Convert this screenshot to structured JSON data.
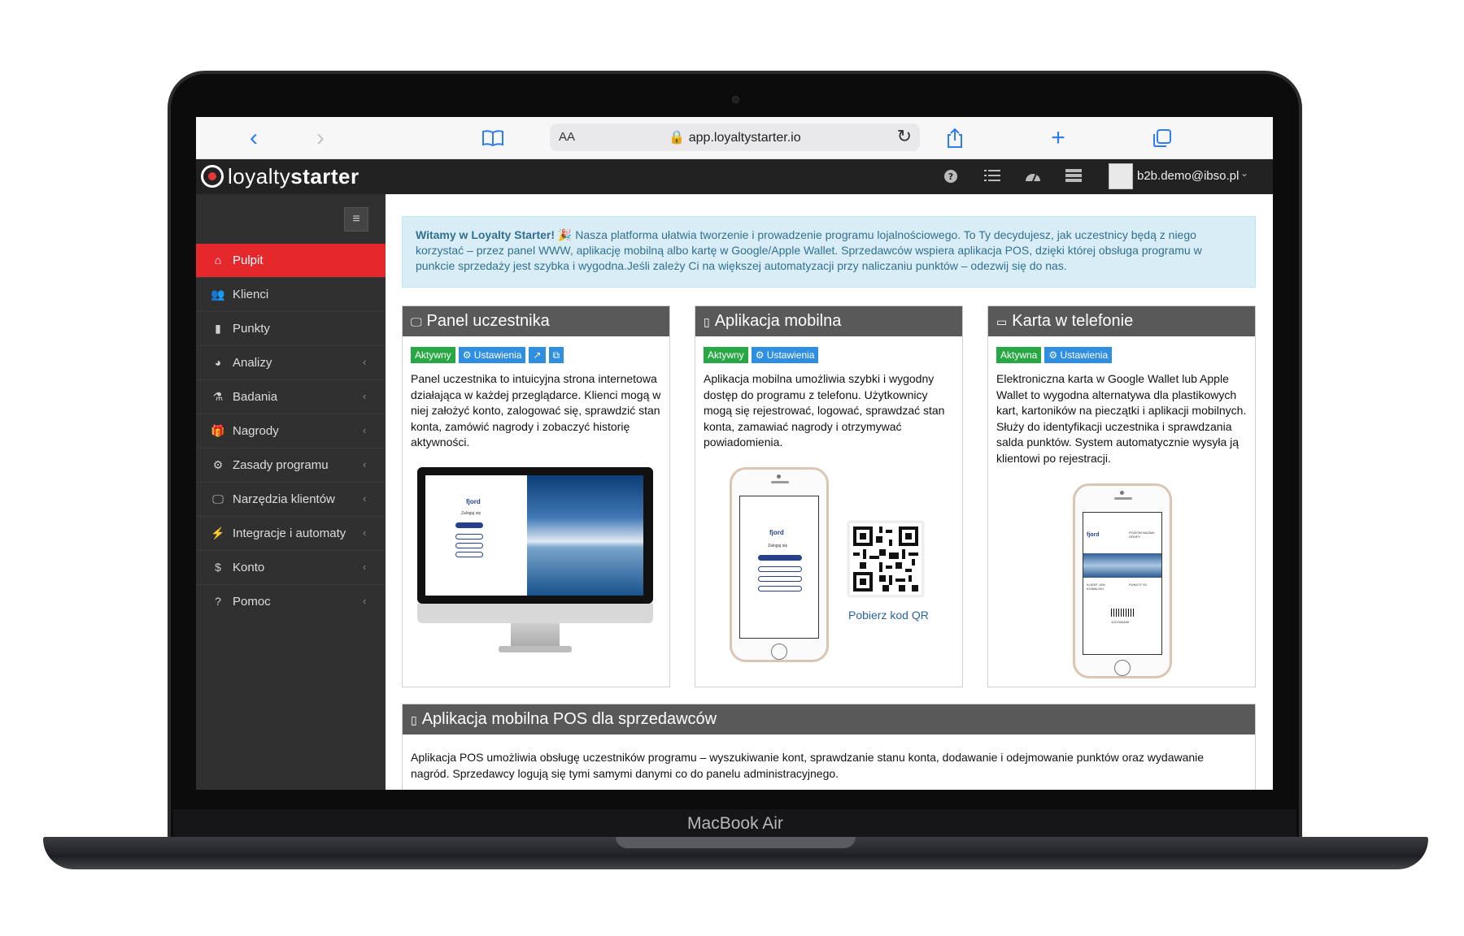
{
  "device": {
    "brand": "MacBook Air"
  },
  "browser": {
    "text_size_label": "AA",
    "url": "app.loyaltystarter.io",
    "icons": [
      "back-icon",
      "forward-icon",
      "bookmarks-icon",
      "reload-icon",
      "share-icon",
      "new-tab-icon",
      "tabs-icon"
    ]
  },
  "header": {
    "logo_light": "loyalty",
    "logo_bold": "starter",
    "user_email": "b2b.demo@ibso.pl",
    "icons": [
      "help-icon",
      "list-icon",
      "dashboard-icon",
      "server-icon"
    ]
  },
  "sidebar": {
    "items": [
      {
        "label": "Pulpit",
        "icon": "home-icon",
        "active": true
      },
      {
        "label": "Klienci",
        "icon": "users-icon"
      },
      {
        "label": "Punkty",
        "icon": "bar-chart-icon"
      },
      {
        "label": "Analizy",
        "icon": "pie-chart-icon"
      },
      {
        "label": "Badania",
        "icon": "flask-icon"
      },
      {
        "label": "Nagrody",
        "icon": "gift-icon"
      },
      {
        "label": "Zasady programu",
        "icon": "gear-icon"
      },
      {
        "label": "Narzędzia klientów",
        "icon": "monitor-icon"
      },
      {
        "label": "Integracje i automaty",
        "icon": "plug-icon"
      },
      {
        "label": "Konto",
        "icon": "dollar-icon"
      },
      {
        "label": "Pomoc",
        "icon": "question-icon"
      }
    ]
  },
  "welcome": {
    "strong": "Witamy w Loyalty Starter!",
    "text": " 🎉 Nasza platforma ułatwia tworzenie i prowadzenie programu lojalnościowego. To Ty decydujesz, jak uczestnicy będą z niego korzystać – przez panel WWW, aplikację mobilną albo kartę w Google/Apple Wallet. Sprzedawców wspiera aplikacja POS, dzięki której obsługa programu w punkcie sprzedaży jest szybka i wygodna.Jeśli zależy Ci na większej automatyzacji przy naliczaniu punktów – odezwij się do nas."
  },
  "cards": [
    {
      "title": "Panel uczestnika",
      "status": "Aktywny",
      "settings": "Ustawienia",
      "text": "Panel uczestnika to intuicyjna strona internetowa działająca w każdej przeglądarce. Klienci mogą w niej założyć konto, zalogować się, sprawdzić stan konta, zamówić nagrody i zobaczyć historię aktywności."
    },
    {
      "title": "Aplikacja mobilna",
      "status": "Aktywny",
      "settings": "Ustawienia",
      "text": "Aplikacja mobilna umożliwia szybki i wygodny dostęp do programu z telefonu. Użytkownicy mogą się rejestrować, logować, sprawdzać stan konta, zamawiać nagrody i otrzymywać powiadomienia.",
      "qr_label": "Pobierz kod QR"
    },
    {
      "title": "Karta w telefonie",
      "status": "Aktywna",
      "settings": "Ustawienia",
      "text": "Elektroniczna karta w Google Wallet lub Apple Wallet to wygodna alternatywa dla plastikowych kart, kartoników na pieczątki i aplikacji mobilnych. Służy do identyfikacji uczestnika i sprawdzania salda punktów. System automatycznie wysyła ją klientowi po rejestracji."
    }
  ],
  "mockup": {
    "brand": "fjord",
    "login_title": "Zaloguj się",
    "wallet_header_right": "POZIOM NAZWA GRUPY",
    "wallet_client": "KLIENT JAN KOWALSKI",
    "wallet_points": "PUNKTY 93",
    "wallet_number": "1122334455"
  },
  "pos": {
    "title": "Aplikacja mobilna POS dla sprzedawców",
    "text": "Aplikacja POS umożliwia obsługę uczestników programu – wyszukiwanie kont, sprawdzanie stanu konta, dodawanie i odejmowanie punktów oraz wydawanie nagród. Sprzedawcy logują się tymi samymi danymi co do panelu administracyjnego."
  },
  "colors": {
    "active": "#e4282c",
    "success": "#27a844",
    "info": "#2f8ee0",
    "header": "#222222",
    "sidebar": "#303030"
  }
}
